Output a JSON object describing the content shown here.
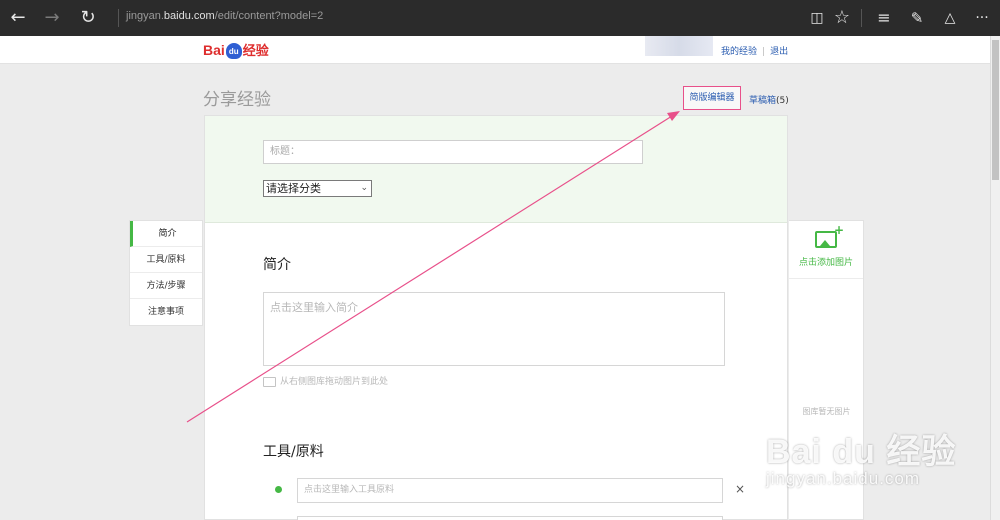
{
  "browser": {
    "url_prefix": "jingyan.",
    "url_domain": "baidu.com",
    "url_path": "/edit/content?model=2",
    "icons": [
      "back-icon",
      "forward-icon",
      "refresh-icon",
      "reading-view-icon",
      "favorite-star-icon",
      "hub-icon",
      "web-note-icon",
      "share-icon",
      "more-icon"
    ]
  },
  "header": {
    "logo_text_1": "Bai",
    "logo_text_2": "du",
    "logo_text_3": "经验",
    "my_experience": "我的经验",
    "separator": "|",
    "logout": "退出"
  },
  "page": {
    "title": "分享经验",
    "simple_editor": "简版编辑器",
    "drafts_label": "草稿箱",
    "drafts_count": "(5)"
  },
  "form": {
    "title_placeholder": "标题：",
    "category_placeholder": "请选择分类",
    "intro_heading": "简介",
    "intro_placeholder": "点击这里输入简介",
    "drag_tip": "从右侧图库拖动图片到此处",
    "tools_heading": "工具/原料",
    "tool_placeholder": "点击这里输入工具原料",
    "tool_delete": "×"
  },
  "side_nav": {
    "items": [
      {
        "label": "简介"
      },
      {
        "label": "工具/原料"
      },
      {
        "label": "方法/步骤"
      },
      {
        "label": "注意事项"
      }
    ]
  },
  "image_panel": {
    "add_label": "点击添加图片",
    "empty_label": "图库暂无图片"
  },
  "watermark": {
    "brand": "Bai du 经验",
    "url": "jingyan.baidu.com"
  },
  "colors": {
    "accent_green": "#45b845",
    "link_blue": "#2a5cb0",
    "highlight_pink": "#e8508a",
    "brand_red": "#de2d2d"
  }
}
